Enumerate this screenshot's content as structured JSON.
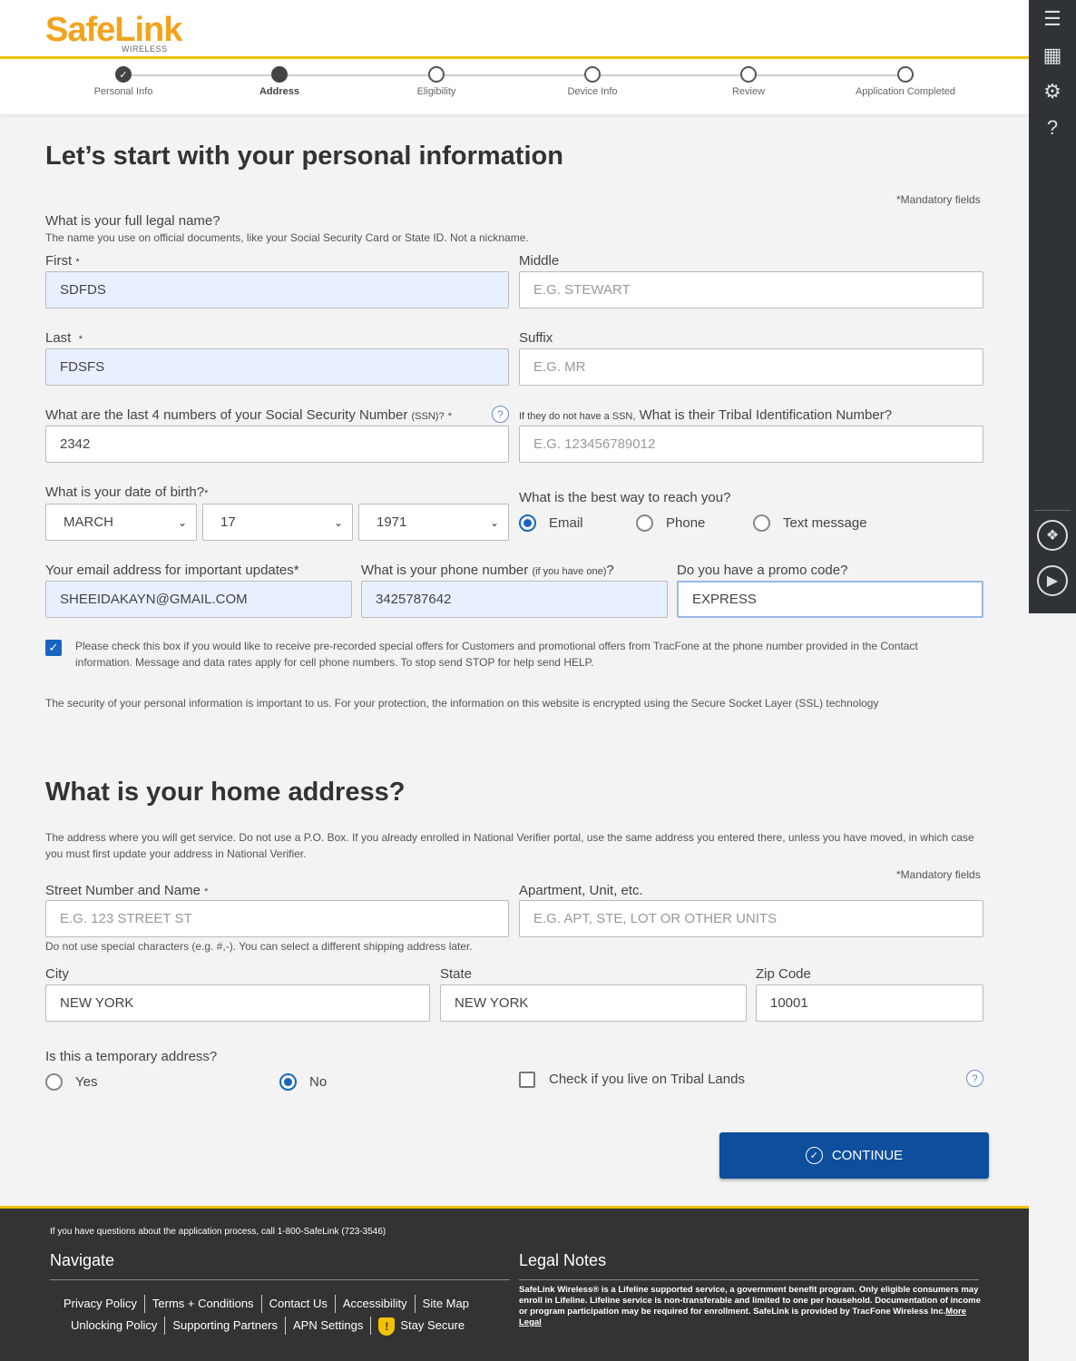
{
  "header": {
    "logo_text": "SafeLink",
    "logo_sub": "WIRELESS",
    "steps": [
      {
        "label": "Personal Info",
        "state": "done"
      },
      {
        "label": "Address",
        "state": "active"
      },
      {
        "label": "Eligibility",
        "state": "todo"
      },
      {
        "label": "Device Info",
        "state": "todo"
      },
      {
        "label": "Review",
        "state": "todo"
      },
      {
        "label": "Application Completed",
        "state": "todo"
      }
    ]
  },
  "sidebar": {
    "icons": [
      "menu-icon",
      "apps-grid-icon",
      "settings-icon",
      "help-icon",
      "widget-icon",
      "play-icon"
    ]
  },
  "personal": {
    "heading": "Let’s start with your personal information",
    "mandatory": "*Mandatory fields",
    "name_question": "What is your full legal name?",
    "name_hint": "The name you use on official documents, like your Social Security Card or State ID. Not a nickname.",
    "first_label": "First",
    "first_value": "SDFDS",
    "middle_label": "Middle",
    "middle_placeholder": "E.G. STEWART",
    "last_label": "Last",
    "last_value": "FDSFS",
    "suffix_label": "Suffix",
    "suffix_placeholder": "E.G. MR",
    "ssn_label": "What are the last 4 numbers of your Social Security Number",
    "ssn_small": "(SSN)?",
    "ssn_value": "2342",
    "tribal_small": "If they do not have a SSN,",
    "tribal_label": "What is their Tribal Identification Number?",
    "tribal_placeholder": "E.G. 123456789012",
    "dob_label": "What is your date of birth?",
    "dob_month": "MARCH",
    "dob_day": "17",
    "dob_year": "1971",
    "reach_label": "What is the best way to reach you?",
    "reach_options": [
      "Email",
      "Phone",
      "Text message"
    ],
    "email_label": "Your email address for important updates*",
    "email_value": "SHEEIDAKAYN@GMAIL.COM",
    "phone_label": "What is your phone number",
    "phone_small": "(if you have one)",
    "phone_value": "3425787642",
    "promo_label": "Do you have a promo code?",
    "promo_value": "EXPRESS",
    "consent_text": "Please check this box if you would like to receive pre-recorded special offers for Customers and promotional offers from TracFone at the phone number provided in the Contact information. Message and data rates apply for cell phone numbers. To stop send STOP for help send HELP.",
    "security_text": "The security of your personal information is important to us. For your protection, the information on this website is encrypted using the Secure Socket Layer (SSL) technology"
  },
  "address": {
    "heading": "What is your home address?",
    "intro": "The address where you will get service. Do not use a P.O. Box. If you already enrolled in National Verifier portal, use the same address you entered there, unless you have moved, in which case you must first update your address in National Verifier.",
    "mandatory": "*Mandatory fields",
    "street_label": "Street Number and Name",
    "street_placeholder": "E.G. 123 STREET ST",
    "apt_label": "Apartment, Unit, etc.",
    "apt_placeholder": "E.G. APT, STE, LOT OR OTHER UNITS",
    "street_note": "Do not use special characters (e.g. #,-). You can select a different shipping address later.",
    "city_label": "City",
    "city_value": "NEW YORK",
    "state_label": "State",
    "state_value": "NEW YORK",
    "zip_label": "Zip Code",
    "zip_value": "10001",
    "temp_label": "Is this a temporary address?",
    "temp_yes": "Yes",
    "temp_no": "No",
    "tribal_lands": "Check if you live on Tribal Lands",
    "continue": "CONTINUE"
  },
  "footer": {
    "question": "If you have questions about the application process, call 1-800-SafeLink (723-3546)",
    "navigate": "Navigate",
    "legal_title": "Legal Notes",
    "links_row1": [
      "Privacy Policy",
      "Terms + Conditions",
      "Contact Us",
      "Accessibility",
      "Site Map"
    ],
    "links_row2": [
      "Unlocking Policy",
      "Supporting Partners",
      "APN Settings",
      "Stay Secure"
    ],
    "legal_text": "SafeLink Wireless® is a Lifeline supported service, a government benefit program. Only eligible consumers may enroll in Lifeline. Lifeline service is non-transferable and limited to one per household. Documentation of income or program participation may be required for enrollment. SafeLink is provided by TracFone Wireless Inc.",
    "more_legal": "More Legal"
  },
  "colors": {
    "brand_yellow": "#f2a31b",
    "accent_blue": "#0d4f9c",
    "footer_bg": "#333333"
  }
}
